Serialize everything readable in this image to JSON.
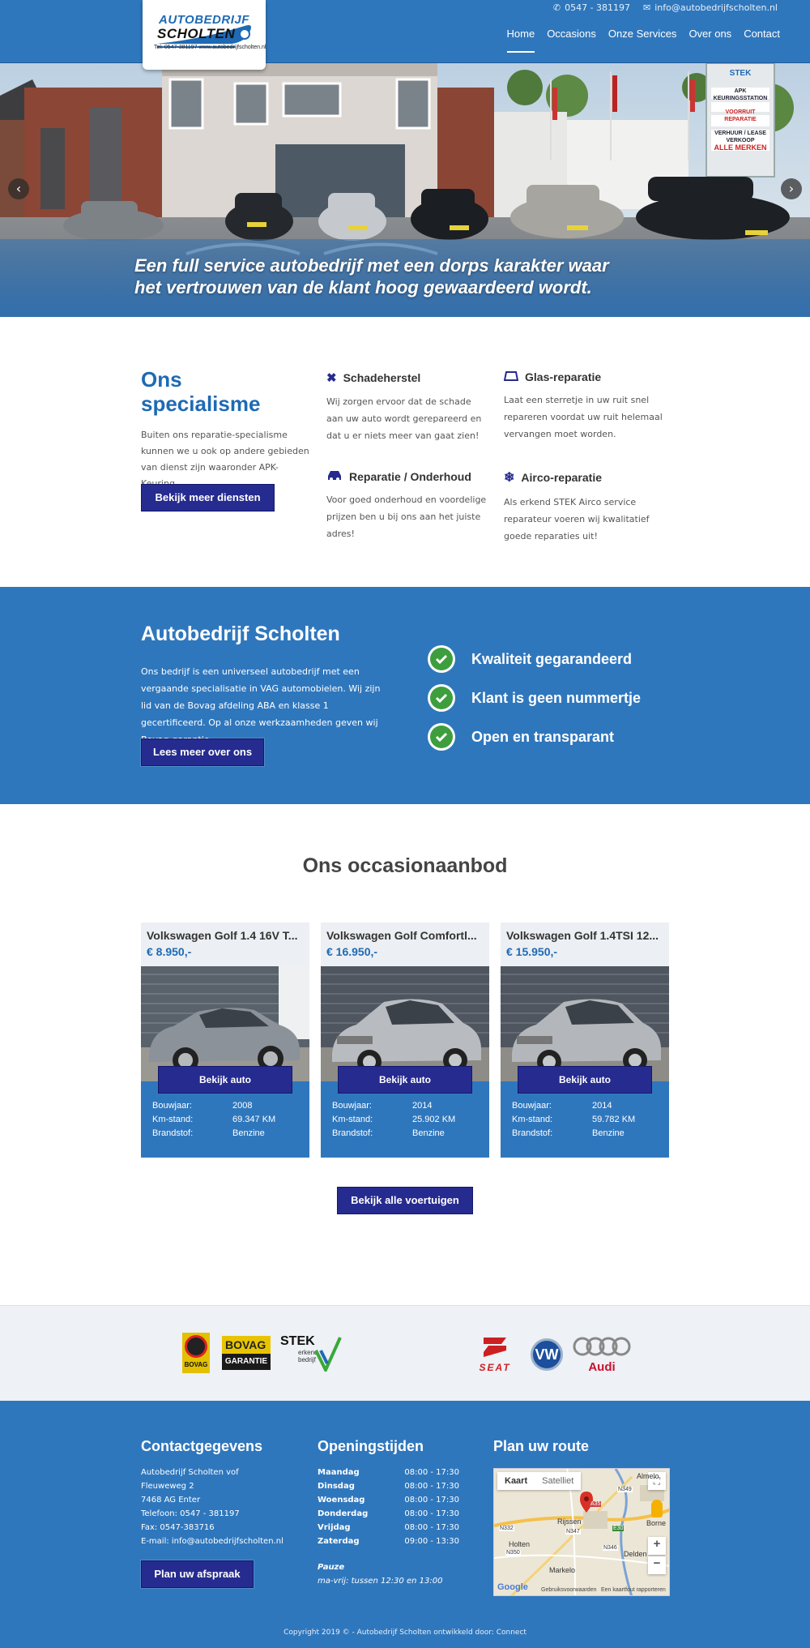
{
  "header": {
    "phone": "0547 - 381197",
    "email": "info@autobedrijfscholten.nl",
    "logo": {
      "line1": "AUTOBEDRIJF",
      "line2": "SCHOLTEN",
      "line3": "Tel: 0547-381197  www.autobedrijfscholten.nl"
    },
    "nav": [
      "Home",
      "Occasions",
      "Onze Services",
      "Over ons",
      "Contact"
    ],
    "active_nav": "Home"
  },
  "hero": {
    "caption_line1": "Een full service autobedrijf met een dorps karakter waar",
    "caption_line2": "het vertrouwen van de klant hoog gewaardeerd wordt.",
    "prev": "‹",
    "next": "›",
    "sign": {
      "brand": "STEK",
      "l1": "APK KEURINGSSTATION",
      "l2": "VOORRUIT REPARATIE",
      "l3": "VERHUUR / LEASE",
      "l4": "VERKOOP",
      "l5": "ALLE MERKEN"
    }
  },
  "specialisme": {
    "title_line1": "Ons",
    "title_line2": "specialisme",
    "intro": "Buiten ons reparatie-specialisme kunnen we u ook op andere gebieden van dienst zijn waaronder APK-Keuring.",
    "button": "Bekijk meer diensten",
    "services": [
      {
        "title": "Schadeherstel",
        "text": "Wij zorgen ervoor dat de schade aan uw auto wordt gerepareerd en dat u er niets meer van gaat zien!",
        "icon": "tools-icon"
      },
      {
        "title": "Glas-reparatie",
        "text": "Laat een sterretje in uw ruit snel repareren voordat uw ruit helemaal vervangen moet worden.",
        "icon": "windshield-icon"
      },
      {
        "title": "Reparatie / Onderhoud",
        "text": "Voor goed onderhoud en voordelige prijzen ben u bij ons aan het juiste adres!",
        "icon": "car-repair-icon"
      },
      {
        "title": "Airco-reparatie",
        "text": "Als erkend STEK Airco service reparateur voeren wij kwalitatief goede reparaties uit!",
        "icon": "snowflake-icon"
      }
    ]
  },
  "about": {
    "title": "Autobedrijf Scholten",
    "text": "Ons bedrijf is een universeel autobedrijf met een vergaande specialisatie in VAG automobielen. Wij zijn lid van de Bovag afdeling ABA en klasse 1 gecertificeerd. Op al onze werkzaamheden geven wij Bovag-garantie.",
    "button": "Lees meer over ons",
    "features": [
      "Kwaliteit gegarandeerd",
      "Klant is geen nummertje",
      "Open en transparant"
    ]
  },
  "occasions": {
    "title": "Ons occasionaanbod",
    "cars": [
      {
        "name": "Volkswagen Golf 1.4 16V T...",
        "price": "€ 8.950,-",
        "button": "Bekijk auto",
        "bouwjaar_label": "Bouwjaar:",
        "bouwjaar": "2008",
        "km_label": "Km-stand:",
        "km": "69.347 KM",
        "brandstof_label": "Brandstof:",
        "brandstof": "Benzine"
      },
      {
        "name": "Volkswagen Golf Comfortl...",
        "price": "€ 16.950,-",
        "button": "Bekijk auto",
        "bouwjaar_label": "Bouwjaar:",
        "bouwjaar": "2014",
        "km_label": "Km-stand:",
        "km": "25.902 KM",
        "brandstof_label": "Brandstof:",
        "brandstof": "Benzine"
      },
      {
        "name": "Volkswagen Golf 1.4TSI 12...",
        "price": "€ 15.950,-",
        "button": "Bekijk auto",
        "bouwjaar_label": "Bouwjaar:",
        "bouwjaar": "2014",
        "km_label": "Km-stand:",
        "km": "59.782 KM",
        "brandstof_label": "Brandstof:",
        "brandstof": "Benzine"
      }
    ],
    "all_button": "Bekijk alle voertuigen"
  },
  "partners": {
    "bovag": "BOVAG",
    "bovag_garantie_1": "BOVAG",
    "bovag_garantie_2": "GARANTIE",
    "stek": "STEK",
    "stek_sub1": "erkend",
    "stek_sub2": "bedrijf",
    "seat": "SEAT",
    "audi": "Audi"
  },
  "footer": {
    "contact_title": "Contactgegevens",
    "contact_lines": [
      "Autobedrijf Scholten vof",
      "Fleuweweg 2",
      "7468 AG Enter",
      "Telefoon: 0547 - 381197",
      "Fax: 0547-383716",
      "E-mail: info@autobedrijfscholten.nl"
    ],
    "appointment_button": "Plan uw afspraak",
    "hours_title": "Openingstijden",
    "hours": [
      {
        "day": "Maandag",
        "time": "08:00 - 17:30"
      },
      {
        "day": "Dinsdag",
        "time": "08:00 - 17:30"
      },
      {
        "day": "Woensdag",
        "time": "08:00 - 17:30"
      },
      {
        "day": "Donderdag",
        "time": "08:00 - 17:30"
      },
      {
        "day": "Vrijdag",
        "time": "08:00 - 17:30"
      },
      {
        "day": "Zaterdag",
        "time": "09:00 - 13:30"
      }
    ],
    "pause_title": "Pauze",
    "pause_text": "ma-vrij: tussen 12:30 en 13:00",
    "route_title": "Plan uw route",
    "map": {
      "tab_map": "Kaart",
      "tab_sat": "Satelliet",
      "labels": [
        "Almelo",
        "Rijssen",
        "Borne",
        "Holten",
        "Markelo",
        "Delden",
        "Enter"
      ],
      "roads": [
        "N349",
        "A35",
        "N332",
        "N347",
        "N350",
        "N346",
        "E30",
        "A1"
      ],
      "zoom_in": "+",
      "zoom_out": "−",
      "google": "Google",
      "terms": "Gebruiksvoorwaarden",
      "report": "Een kaartfout rapporteren"
    },
    "copyright": "Copyright 2019 © - Autobedrijf Scholten ontwikkeld door: Connect"
  },
  "colors": {
    "primary": "#2f77bd",
    "button": "#252b8f",
    "accent_heading": "#1e6ab4",
    "check_green": "#3e9e3e"
  }
}
